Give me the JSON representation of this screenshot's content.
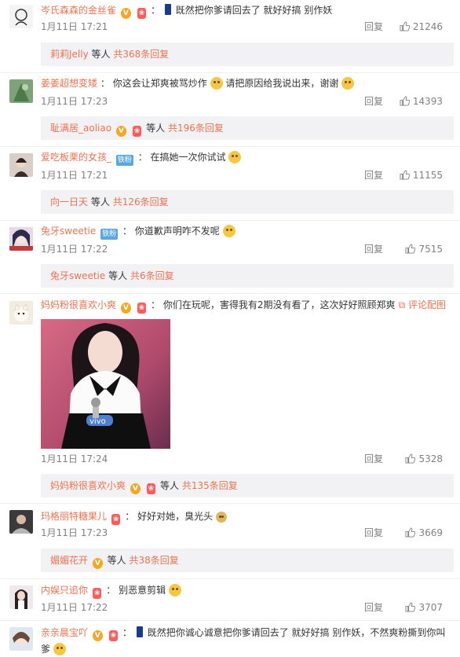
{
  "comments": [
    {
      "user": "岑氏森森的金丝雀",
      "text": "既然把你爹请回去了  就好好搞  别作妖",
      "time": "1月11日 17:21",
      "reply_label": "回复",
      "likes": "21246",
      "sub_user": "莉莉Jelly",
      "sub_mid": "等人",
      "sub_count": "共368条回复"
    },
    {
      "user": "姜姜超想变矮",
      "text": "你这会让郑爽被骂炒作",
      "text2": "请把原因给我说出来，谢谢",
      "time": "1月11日 17:23",
      "reply_label": "回复",
      "likes": "14393",
      "sub_user": "耻满居_aoliao",
      "sub_mid": "等人",
      "sub_count": "共196条回复"
    },
    {
      "user": "爱吃板栗的女孩_",
      "fan_badge": "铁粉",
      "text": "在搞她一次你试试",
      "time": "1月11日 17:21",
      "reply_label": "回复",
      "likes": "11155",
      "sub_user": "向一日天",
      "sub_mid": "等人",
      "sub_count": "共126条回复"
    },
    {
      "user": "兔牙sweetie",
      "fan_badge": "铁粉",
      "text": "你道歉声明咋不发呢",
      "time": "1月11日 17:22",
      "reply_label": "回复",
      "likes": "7515",
      "sub_user": "兔牙sweetie",
      "sub_mid": "等人",
      "sub_count": "共6条回复"
    },
    {
      "user": "妈妈粉很喜欢小爽",
      "text": "你们在玩呢，害得我有2期没有看了，这次好好照顾郑爽",
      "view_image": "评论配图",
      "time": "1月11日 17:24",
      "reply_label": "回复",
      "likes": "5328",
      "sub_user": "妈妈粉很喜欢小爽",
      "sub_mid": "等人",
      "sub_count": "共135条回复",
      "photo_mic_text": "vivo"
    },
    {
      "user": "玛格丽特糖果儿",
      "text": "好好对她，臭光头",
      "time": "1月11日 17:23",
      "reply_label": "回复",
      "likes": "3669",
      "sub_user": "媚媚花开",
      "sub_mid": "等人",
      "sub_count": "共38条回复"
    },
    {
      "user": "内娱只追你",
      "text": "别恶意剪辑",
      "time": "1月11日 17:22",
      "reply_label": "回复",
      "likes": "3707"
    },
    {
      "user": "亲亲晨宝吖",
      "text": "既然把你诚心诚意把你爹请回去了  就好好搞  别作妖，不然爽粉撕到你叫",
      "text2": "爹"
    }
  ],
  "colors": {
    "link": "#eb7350",
    "meta": "#808080",
    "subbox_bg": "#f2f2f5"
  }
}
